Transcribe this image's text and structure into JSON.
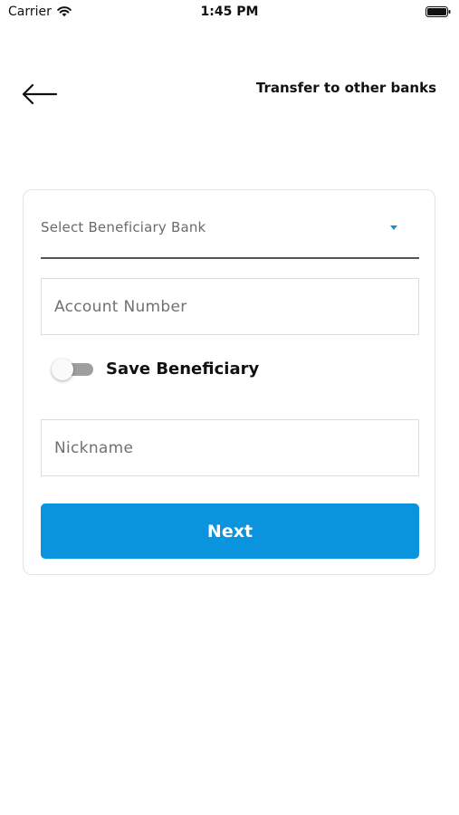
{
  "status_bar": {
    "carrier": "Carrier",
    "time": "1:45 PM",
    "wifi_icon": "wifi-icon",
    "battery_icon": "battery-icon"
  },
  "header": {
    "back_icon": "arrow-left-icon",
    "title": "Transfer to other banks"
  },
  "form": {
    "bank_select": {
      "placeholder": "Select Beneficiary Bank",
      "icon": "dropdown-arrow-icon"
    },
    "account_number": {
      "placeholder": "Account Number",
      "value": ""
    },
    "save_beneficiary": {
      "label": "Save Beneficiary",
      "enabled": false
    },
    "nickname": {
      "placeholder": "Nickname",
      "value": ""
    },
    "next_label": "Next"
  },
  "colors": {
    "accent": "#0a94de",
    "dropdown_arrow": "#1790d8",
    "toggle_off_track": "#9e9e9e"
  }
}
